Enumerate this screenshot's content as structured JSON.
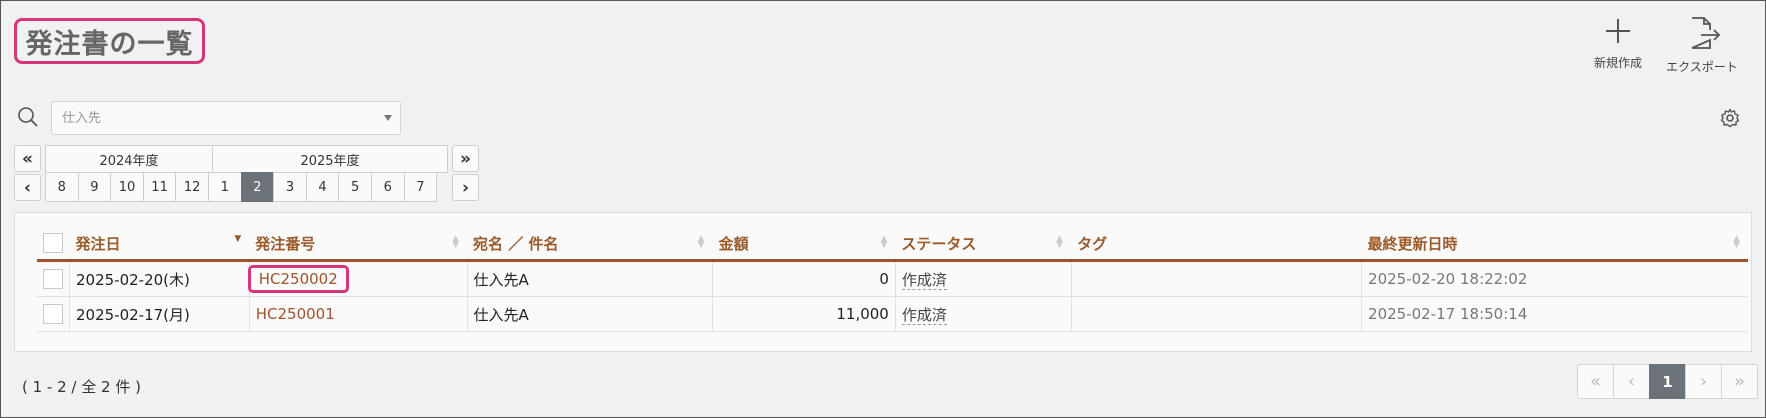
{
  "header": {
    "title": "発注書の一覧"
  },
  "toolbar": {
    "new_label": "新規作成",
    "export_label": "エクスポート"
  },
  "search": {
    "placeholder": "仕入先"
  },
  "period": {
    "years": [
      "2024年度",
      "2025年度"
    ],
    "months": [
      "8",
      "9",
      "10",
      "11",
      "12",
      "1",
      "2",
      "3",
      "4",
      "5",
      "6",
      "7"
    ],
    "selected_month": "2",
    "nav": {
      "prev_year": "«",
      "prev": "‹",
      "next_year": "»",
      "next": "›"
    }
  },
  "table": {
    "columns": [
      "発注日",
      "発注番号",
      "宛名 ／ 件名",
      "金額",
      "ステータス",
      "タグ",
      "最終更新日時"
    ],
    "rows": [
      {
        "date": "2025-02-20(木)",
        "number": "HC250002",
        "name": "仕入先A",
        "amount": "0",
        "status": "作成済",
        "tag": "",
        "updated": "2025-02-20 18:22:02"
      },
      {
        "date": "2025-02-17(月)",
        "number": "HC250001",
        "name": "仕入先A",
        "amount": "11,000",
        "status": "作成済",
        "tag": "",
        "updated": "2025-02-17 18:50:14"
      }
    ]
  },
  "footer": {
    "count_text": "( 1 - 2 / 全 2 件 )"
  },
  "pagination": {
    "first": "«",
    "prev": "‹",
    "current": "1",
    "next": "›",
    "last": "»"
  },
  "colors": {
    "accent": "#a0522d",
    "highlight": "#d6357a",
    "active": "#6b7278"
  },
  "icons": [
    "search-icon",
    "gear-icon",
    "plus-icon",
    "export-icon"
  ]
}
